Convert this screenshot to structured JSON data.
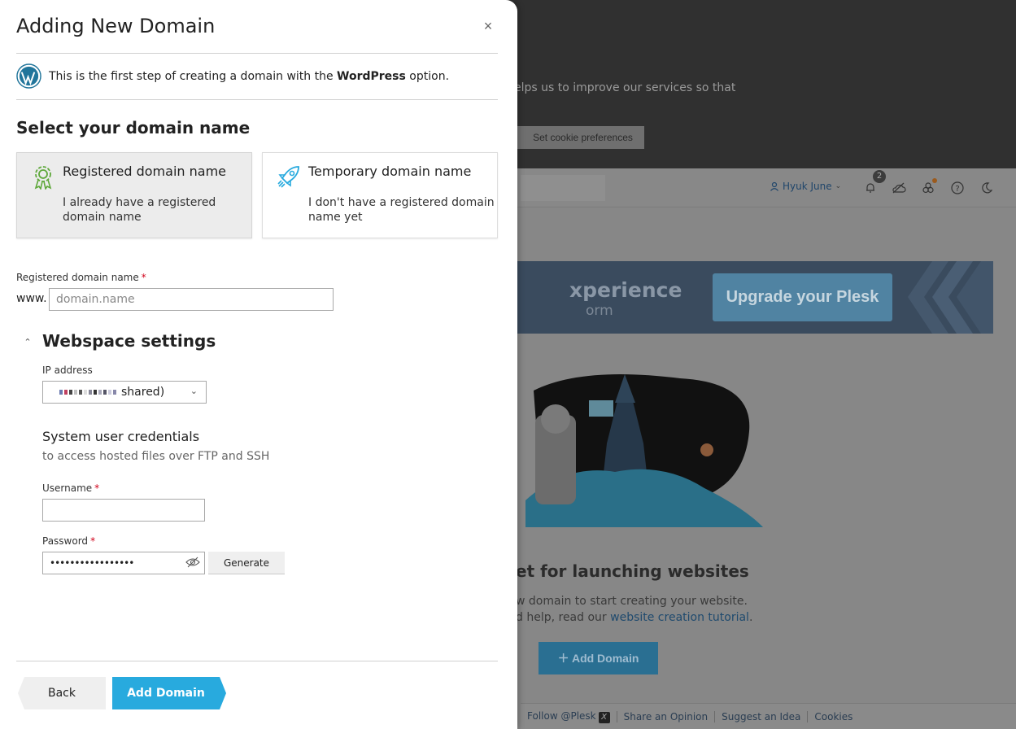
{
  "background": {
    "cookie_text": "elps us to improve our services so that",
    "cookie_button": "Set cookie preferences",
    "user_name": "Hyuk June",
    "notification_count": "2",
    "banner_title": "xperience",
    "banner_subtitle": "orm",
    "banner_button": "Upgrade your Plesk",
    "empty_title": "et for launching websites",
    "empty_line1": "w domain to start creating your website.",
    "empty_line2_prefix": "d help, read our ",
    "empty_line2_link": "website creation tutorial",
    "empty_line2_suffix": ".",
    "add_domain_button": "Add Domain",
    "footer": {
      "follow": "Follow @Plesk",
      "opinion": "Share an Opinion",
      "idea": "Suggest an Idea",
      "cookies": "Cookies"
    }
  },
  "modal": {
    "title": "Adding New Domain",
    "close_symbol": "×",
    "info_prefix": "This is the first step of creating a domain with the ",
    "info_bold": "WordPress",
    "info_suffix": " option.",
    "section_title": "Select your domain name",
    "cards": [
      {
        "title": "Registered domain name",
        "desc": "I already have a registered domain name",
        "selected": true
      },
      {
        "title": "Temporary domain name",
        "desc": "I don't have a registered domain name yet",
        "selected": false
      }
    ],
    "domain_label": "Registered domain name",
    "required_mark": "*",
    "www_prefix": "www.",
    "domain_placeholder": "domain.name",
    "domain_value": "",
    "webspace_title": "Webspace settings",
    "ip_label": "IP address",
    "ip_value_suffix": "shared)",
    "credentials_title": "System user credentials",
    "credentials_desc": "to access hosted files over FTP and SSH",
    "username_label": "Username",
    "username_value": "",
    "password_label": "Password",
    "password_value": "•••••••••••••••••",
    "generate_button": "Generate",
    "back_button": "Back",
    "add_button": "Add Domain"
  },
  "colors": {
    "accent": "#28aade",
    "required": "#d0021b",
    "card_selected_bg": "#ececec"
  }
}
